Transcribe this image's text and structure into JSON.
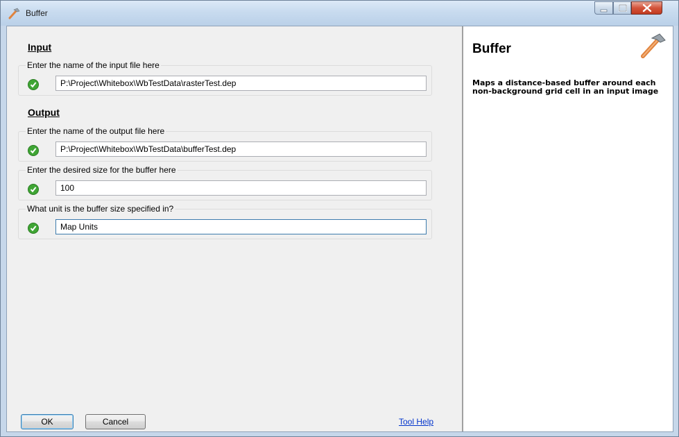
{
  "window": {
    "title": "Buffer"
  },
  "input_section": {
    "heading": "Input",
    "fields": [
      {
        "label": "Enter the name of the input file here",
        "value": "P:\\Project\\Whitebox\\WbTestData\\rasterTest.dep"
      }
    ]
  },
  "output_section": {
    "heading": "Output",
    "fields": [
      {
        "label": "Enter the name of the output file here",
        "value": "P:\\Project\\Whitebox\\WbTestData\\bufferTest.dep"
      },
      {
        "label": "Enter the desired size for the buffer here",
        "value": "100"
      },
      {
        "label": "What unit is the buffer size specified in?",
        "value": "Map Units"
      }
    ]
  },
  "buttons": {
    "ok": "OK",
    "cancel": "Cancel",
    "tool_help": "Tool Help"
  },
  "help": {
    "title": "Buffer",
    "description": "Maps a distance-based buffer around each non-background grid cell in an input image"
  },
  "colors": {
    "valid_check": "#3fa534",
    "hammer_handle": "#e0833e",
    "hammer_head": "#9aa3ab"
  },
  "icons": {
    "title": "hammer-icon",
    "valid": "check-circle-icon",
    "help": "hammer-icon"
  }
}
